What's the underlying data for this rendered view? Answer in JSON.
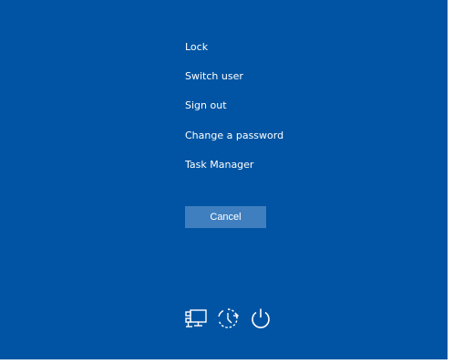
{
  "menu": {
    "items": [
      {
        "label": "Lock"
      },
      {
        "label": "Switch user"
      },
      {
        "label": "Sign out"
      },
      {
        "label": "Change a password"
      },
      {
        "label": "Task Manager"
      }
    ]
  },
  "cancel": {
    "label": "Cancel"
  },
  "bottom_icons": {
    "network": "network-icon",
    "accessibility": "ease-of-access-icon",
    "power": "power-icon"
  },
  "colors": {
    "background": "#0054a3",
    "button": "#3f7fbf",
    "text": "#ffffff"
  }
}
